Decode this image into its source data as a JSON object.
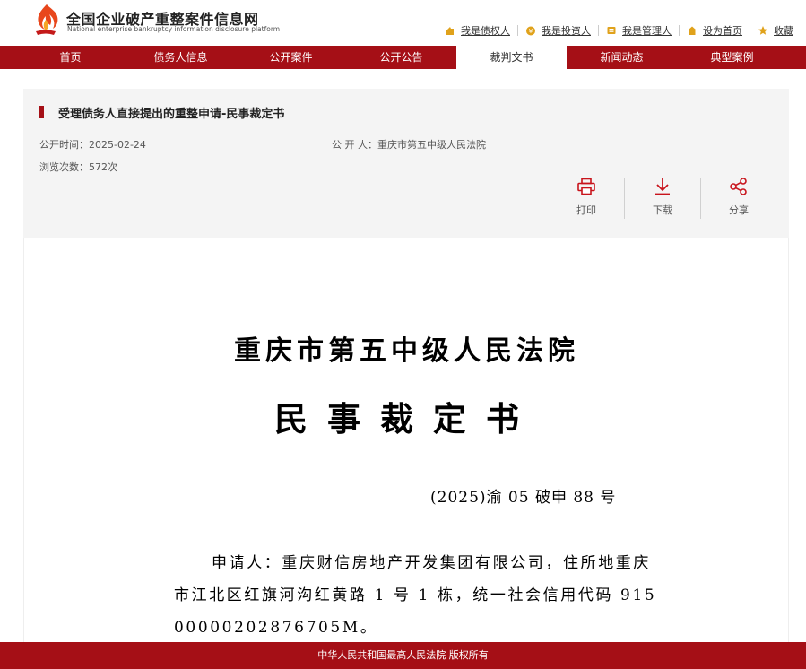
{
  "header": {
    "site_title": "全国企业破产重整案件信息网",
    "site_subtitle": "National enterprise bankruptcy  information disclosure platform",
    "links": [
      {
        "label": "我是债权人",
        "icon": "creditor-icon"
      },
      {
        "label": "我是投资人",
        "icon": "investor-icon"
      },
      {
        "label": "我是管理人",
        "icon": "administrator-icon"
      },
      {
        "label": "设为首页",
        "icon": "home-icon"
      },
      {
        "label": "收藏",
        "icon": "star-icon"
      }
    ]
  },
  "nav": {
    "items": [
      "首页",
      "债务人信息",
      "公开案件",
      "公开公告",
      "裁判文书",
      "新闻动态",
      "典型案例"
    ],
    "active": "裁判文书"
  },
  "info": {
    "title": "受理债务人直接提出的重整申请-民事裁定书",
    "publish_time": "公开时间：2025-02-24",
    "publisher": "公 开 人：重庆市第五中级人民法院",
    "views": "浏览次数：572次",
    "actions": {
      "print": "打印",
      "download": "下载",
      "share": "分享"
    }
  },
  "document": {
    "court": "重庆市第五中级人民法院",
    "doc_type": "民事裁定书",
    "case_number": "(2025)渝 05 破申 88 号",
    "paragraph": "申请人：重庆财信房地产开发集团有限公司，住所地重庆市江北区红旗河沟红黄路 1 号 1 栋，统一社会信用代码 91500000202876705M。"
  },
  "footer": {
    "text": "中华人民共和国最高人民法院 版权所有"
  },
  "colors": {
    "brand_red": "#a50f16",
    "card_bg": "#f4f4f4"
  }
}
